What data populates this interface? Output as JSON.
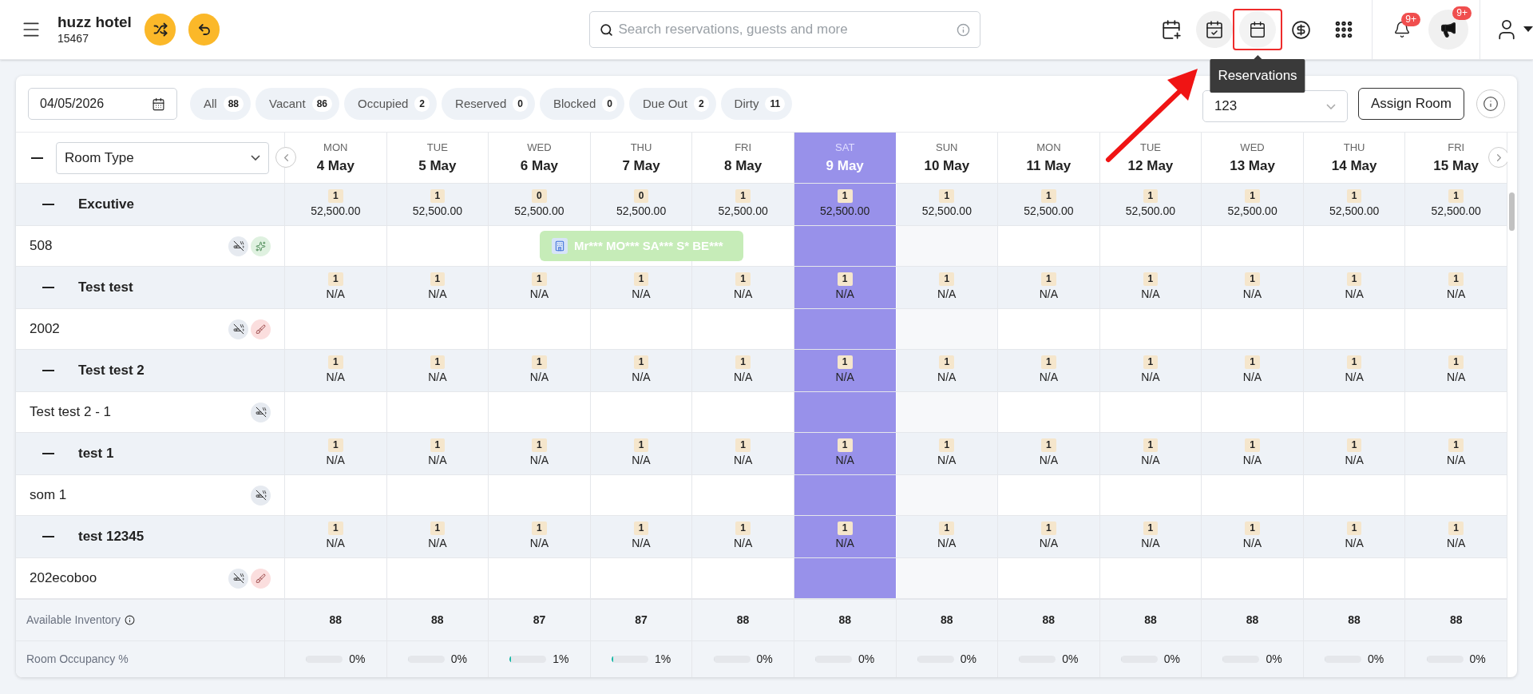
{
  "header": {
    "hotel_name": "huzz hotel",
    "hotel_id": "15467",
    "search": {
      "placeholder": "Search reservations, guests and more"
    },
    "notifications_badge": "9+",
    "announcements_badge": "9+",
    "tooltip": "Reservations"
  },
  "filters": {
    "date": "04/05/2026",
    "chips": [
      {
        "label": "All",
        "count": "88"
      },
      {
        "label": "Vacant",
        "count": "86"
      },
      {
        "label": "Occupied",
        "count": "2"
      },
      {
        "label": "Reserved",
        "count": "0"
      },
      {
        "label": "Blocked",
        "count": "0"
      },
      {
        "label": "Due Out",
        "count": "2"
      },
      {
        "label": "Dirty",
        "count": "11"
      }
    ],
    "rate_plan": "123",
    "assign_button": "Assign Room"
  },
  "grid": {
    "group_by": "Room Type",
    "all_expanded": true,
    "days": [
      {
        "weekday": "MON",
        "date": "4 May",
        "selected": false,
        "shaded": false
      },
      {
        "weekday": "TUE",
        "date": "5 May",
        "selected": false,
        "shaded": false
      },
      {
        "weekday": "WED",
        "date": "6 May",
        "selected": false,
        "shaded": false
      },
      {
        "weekday": "THU",
        "date": "7 May",
        "selected": false,
        "shaded": false
      },
      {
        "weekday": "FRI",
        "date": "8 May",
        "selected": false,
        "shaded": false
      },
      {
        "weekday": "SAT",
        "date": "9 May",
        "selected": true,
        "shaded": false
      },
      {
        "weekday": "SUN",
        "date": "10 May",
        "selected": false,
        "shaded": true
      },
      {
        "weekday": "MON",
        "date": "11 May",
        "selected": false,
        "shaded": false
      },
      {
        "weekday": "TUE",
        "date": "12 May",
        "selected": false,
        "shaded": false
      },
      {
        "weekday": "WED",
        "date": "13 May",
        "selected": false,
        "shaded": false
      },
      {
        "weekday": "THU",
        "date": "14 May",
        "selected": false,
        "shaded": false
      },
      {
        "weekday": "FRI",
        "date": "15 May",
        "selected": false,
        "shaded": false
      }
    ],
    "groups": [
      {
        "name": "Excutive",
        "expanded": true,
        "availability": [
          {
            "count": "1",
            "rate": "52,500.00"
          },
          {
            "count": "1",
            "rate": "52,500.00"
          },
          {
            "count": "0",
            "rate": "52,500.00"
          },
          {
            "count": "0",
            "rate": "52,500.00"
          },
          {
            "count": "1",
            "rate": "52,500.00"
          },
          {
            "count": "1",
            "rate": "52,500.00"
          },
          {
            "count": "1",
            "rate": "52,500.00"
          },
          {
            "count": "1",
            "rate": "52,500.00"
          },
          {
            "count": "1",
            "rate": "52,500.00"
          },
          {
            "count": "1",
            "rate": "52,500.00"
          },
          {
            "count": "1",
            "rate": "52,500.00"
          },
          {
            "count": "1",
            "rate": "52,500.00"
          }
        ],
        "rooms": [
          {
            "name": "508",
            "no_smoking": true,
            "icons": [
              {
                "kind": "clean"
              }
            ],
            "reservation": {
              "guest": "Mr*** MO*** SA*** S* BE***"
            }
          }
        ]
      },
      {
        "name": "Test test",
        "expanded": true,
        "availability": [
          {
            "count": "1",
            "rate": "N/A"
          },
          {
            "count": "1",
            "rate": "N/A"
          },
          {
            "count": "1",
            "rate": "N/A"
          },
          {
            "count": "1",
            "rate": "N/A"
          },
          {
            "count": "1",
            "rate": "N/A"
          },
          {
            "count": "1",
            "rate": "N/A"
          },
          {
            "count": "1",
            "rate": "N/A"
          },
          {
            "count": "1",
            "rate": "N/A"
          },
          {
            "count": "1",
            "rate": "N/A"
          },
          {
            "count": "1",
            "rate": "N/A"
          },
          {
            "count": "1",
            "rate": "N/A"
          },
          {
            "count": "1",
            "rate": "N/A"
          }
        ],
        "rooms": [
          {
            "name": "2002",
            "no_smoking": true,
            "icons": [
              {
                "kind": "dirty"
              }
            ]
          }
        ]
      },
      {
        "name": "Test test 2",
        "expanded": true,
        "availability": [
          {
            "count": "1",
            "rate": "N/A"
          },
          {
            "count": "1",
            "rate": "N/A"
          },
          {
            "count": "1",
            "rate": "N/A"
          },
          {
            "count": "1",
            "rate": "N/A"
          },
          {
            "count": "1",
            "rate": "N/A"
          },
          {
            "count": "1",
            "rate": "N/A"
          },
          {
            "count": "1",
            "rate": "N/A"
          },
          {
            "count": "1",
            "rate": "N/A"
          },
          {
            "count": "1",
            "rate": "N/A"
          },
          {
            "count": "1",
            "rate": "N/A"
          },
          {
            "count": "1",
            "rate": "N/A"
          },
          {
            "count": "1",
            "rate": "N/A"
          }
        ],
        "rooms": [
          {
            "name": "Test test 2 - 1",
            "no_smoking": true
          }
        ]
      },
      {
        "name": "test 1",
        "expanded": true,
        "availability": [
          {
            "count": "1",
            "rate": "N/A"
          },
          {
            "count": "1",
            "rate": "N/A"
          },
          {
            "count": "1",
            "rate": "N/A"
          },
          {
            "count": "1",
            "rate": "N/A"
          },
          {
            "count": "1",
            "rate": "N/A"
          },
          {
            "count": "1",
            "rate": "N/A"
          },
          {
            "count": "1",
            "rate": "N/A"
          },
          {
            "count": "1",
            "rate": "N/A"
          },
          {
            "count": "1",
            "rate": "N/A"
          },
          {
            "count": "1",
            "rate": "N/A"
          },
          {
            "count": "1",
            "rate": "N/A"
          },
          {
            "count": "1",
            "rate": "N/A"
          }
        ],
        "rooms": [
          {
            "name": "som 1",
            "no_smoking": true
          }
        ]
      },
      {
        "name": "test 12345",
        "expanded": true,
        "availability": [
          {
            "count": "1",
            "rate": "N/A"
          },
          {
            "count": "1",
            "rate": "N/A"
          },
          {
            "count": "1",
            "rate": "N/A"
          },
          {
            "count": "1",
            "rate": "N/A"
          },
          {
            "count": "1",
            "rate": "N/A"
          },
          {
            "count": "1",
            "rate": "N/A"
          },
          {
            "count": "1",
            "rate": "N/A"
          },
          {
            "count": "1",
            "rate": "N/A"
          },
          {
            "count": "1",
            "rate": "N/A"
          },
          {
            "count": "1",
            "rate": "N/A"
          },
          {
            "count": "1",
            "rate": "N/A"
          },
          {
            "count": "1",
            "rate": "N/A"
          }
        ],
        "rooms": [
          {
            "name": "202ecoboo",
            "no_smoking": true,
            "icons": [
              {
                "kind": "dirty"
              }
            ]
          }
        ]
      }
    ]
  },
  "footer": {
    "inventory_label": "Available Inventory",
    "inventory": [
      "88",
      "88",
      "87",
      "87",
      "88",
      "88",
      "88",
      "88",
      "88",
      "88",
      "88",
      "88"
    ],
    "occupancy_label": "Room Occupancy %",
    "occupancy": [
      {
        "level": 0,
        "text": "0%"
      },
      {
        "level": 0,
        "text": "0%"
      },
      {
        "level": 0.01,
        "text": "1%"
      },
      {
        "level": 0.01,
        "text": "1%"
      },
      {
        "level": 0,
        "text": "0%"
      },
      {
        "level": 0,
        "text": "0%"
      },
      {
        "level": 0,
        "text": "0%"
      },
      {
        "level": 0,
        "text": "0%"
      },
      {
        "level": 0,
        "text": "0%"
      },
      {
        "level": 0,
        "text": "0%"
      },
      {
        "level": 0,
        "text": "0%"
      },
      {
        "level": 0,
        "text": "0%"
      }
    ]
  }
}
